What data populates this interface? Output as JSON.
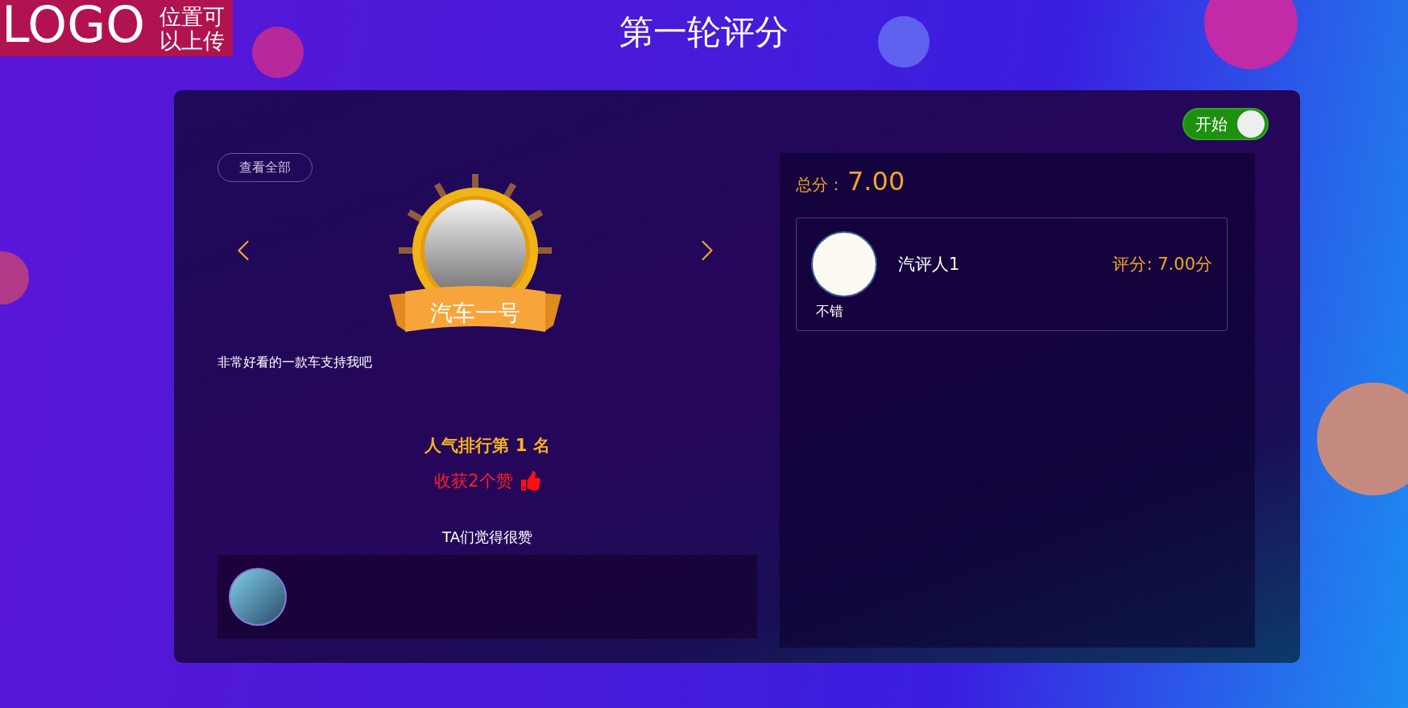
{
  "logo": {
    "text": "LOGO",
    "caption": [
      "位置可",
      "以上传"
    ]
  },
  "title": "第一轮评分",
  "toggle": {
    "label": "开始",
    "on": true
  },
  "view_all": "查看全部",
  "entry": {
    "name": "汽车一号",
    "description": "非常好看的一款车支持我吧"
  },
  "ranking": {
    "rank_text": "人气排行第 1 名",
    "likes_text": "收获2个赞"
  },
  "likers": {
    "title": "TA们觉得很赞",
    "people": [
      {
        "kind": "photo"
      }
    ]
  },
  "score_panel": {
    "total_label": "总分：",
    "total_value": "7.00",
    "reviews": [
      {
        "name": "汽评人1",
        "score": "评分: 7.00分",
        "comment": "不错"
      }
    ]
  }
}
